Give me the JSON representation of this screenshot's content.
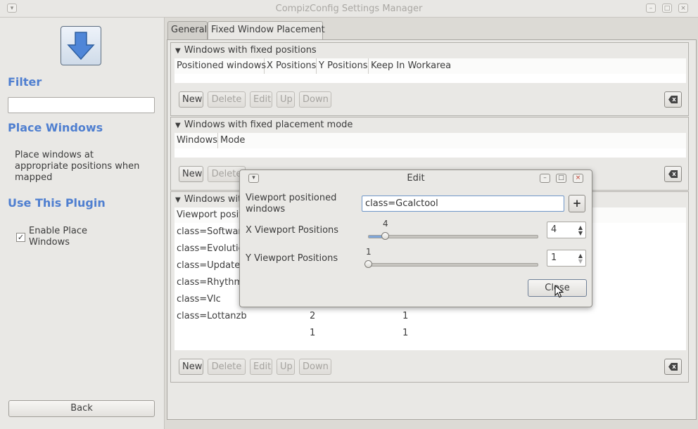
{
  "window": {
    "title": "CompizConfig Settings Manager"
  },
  "sidebar": {
    "filter_heading": "Filter",
    "filter_value": "",
    "plugin_heading": "Place Windows",
    "plugin_description": "Place windows at appropriate positions when mapped",
    "use_heading": "Use This Plugin",
    "enable_label": "Enable Place Windows",
    "enable_checked": true,
    "back_label": "Back"
  },
  "tabs": [
    {
      "label": "General"
    },
    {
      "label": "Fixed Window Placement"
    }
  ],
  "sections": {
    "fixed_positions": {
      "title": "Windows with fixed positions",
      "columns": [
        "Positioned windows",
        "X Positions",
        "Y Positions",
        "Keep In Workarea"
      ]
    },
    "fixed_mode": {
      "title": "Windows with fixed placement mode",
      "columns": [
        "Windows",
        "Mode"
      ]
    },
    "viewport": {
      "title": "Windows wit",
      "column": "Viewport posit",
      "rows": [
        {
          "name": "class=Software",
          "x": "",
          "y": ""
        },
        {
          "name": "class=Evolutio",
          "x": "",
          "y": ""
        },
        {
          "name": "class=Update-",
          "x": "",
          "y": ""
        },
        {
          "name": "class=Rhythmb",
          "x": "",
          "y": ""
        },
        {
          "name": "class=Vlc",
          "x": "",
          "y": ""
        },
        {
          "name": "class=Lottanzb",
          "x": "2",
          "y": "1"
        },
        {
          "name": "",
          "x": "1",
          "y": "1"
        }
      ]
    }
  },
  "buttons": {
    "new": "New",
    "delete": "Delete",
    "edit": "Edit",
    "up": "Up",
    "down": "Down"
  },
  "dialog": {
    "title": "Edit",
    "windows_label": "Viewport positioned windows",
    "windows_value": "class=Gcalctool",
    "x_label": "X Viewport Positions",
    "x_value": 4,
    "x_slider_fraction": 0.1,
    "y_label": "Y Viewport Positions",
    "y_value": 1,
    "y_slider_fraction": 0.0,
    "close_label": "Close"
  },
  "colors": {
    "heading": "#4f7fd0",
    "accent": "#7fa6d8"
  }
}
